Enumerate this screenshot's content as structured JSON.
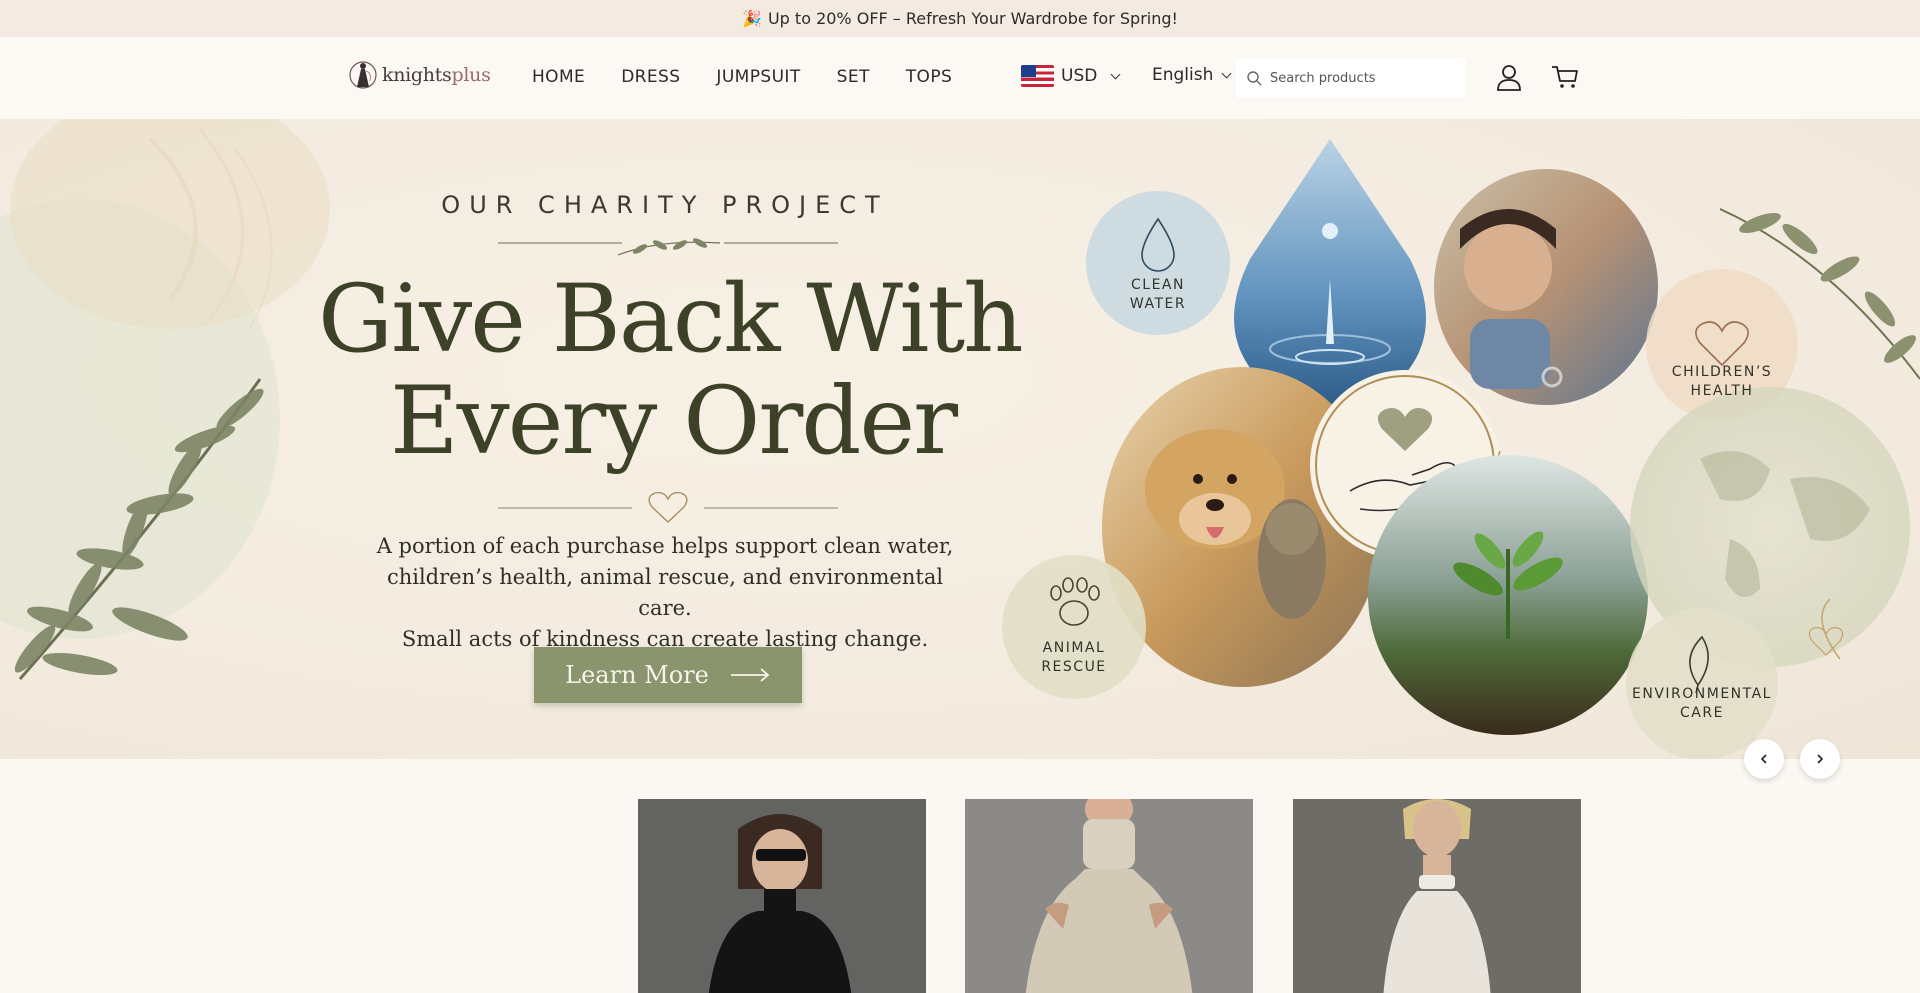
{
  "announcement": {
    "icon": "party-popper-icon",
    "text": "Up to 20% OFF – Refresh Your Wardrobe for Spring!"
  },
  "header": {
    "logo": {
      "brand_main": "knights",
      "brand_accent": "plus"
    },
    "nav": [
      {
        "label": "HOME"
      },
      {
        "label": "DRESS"
      },
      {
        "label": "JUMPSUIT"
      },
      {
        "label": "SET"
      },
      {
        "label": "TOPS"
      }
    ],
    "currency": {
      "value": "USD",
      "flag_icon": "us-flag-icon"
    },
    "language": {
      "value": "English"
    },
    "search": {
      "placeholder": "Search products"
    },
    "icons": [
      "user-icon",
      "cart-icon"
    ]
  },
  "hero": {
    "eyebrow": "OUR CHARITY PROJECT",
    "headline_line1": "Give Back With",
    "headline_line2": "Every Order",
    "description_line1": "A portion of each purchase helps support clean water,",
    "description_line2": "children’s health, animal rescue, and environmental care.",
    "description_line3": "Small acts of kindness can create lasting change.",
    "cta_label": "Learn More",
    "causes": [
      {
        "line1": "CLEAN",
        "line2": "WATER",
        "icon": "water-drop-icon"
      },
      {
        "line1": "CHILDREN’S",
        "line2": "HEALTH",
        "icon": "heart-icon"
      },
      {
        "line1": "ANIMAL",
        "line2": "RESCUE",
        "icon": "paw-icon"
      },
      {
        "line1": "ENVIRONMENTAL",
        "line2": "CARE",
        "icon": "leaf-icon"
      }
    ],
    "colors": {
      "headline": "#3d4128",
      "cta": "#8a946d"
    }
  },
  "products": [
    {
      "image": "model-black-turtleneck"
    },
    {
      "image": "model-knit-halter-top"
    },
    {
      "image": "model-sheer-white-top"
    }
  ]
}
